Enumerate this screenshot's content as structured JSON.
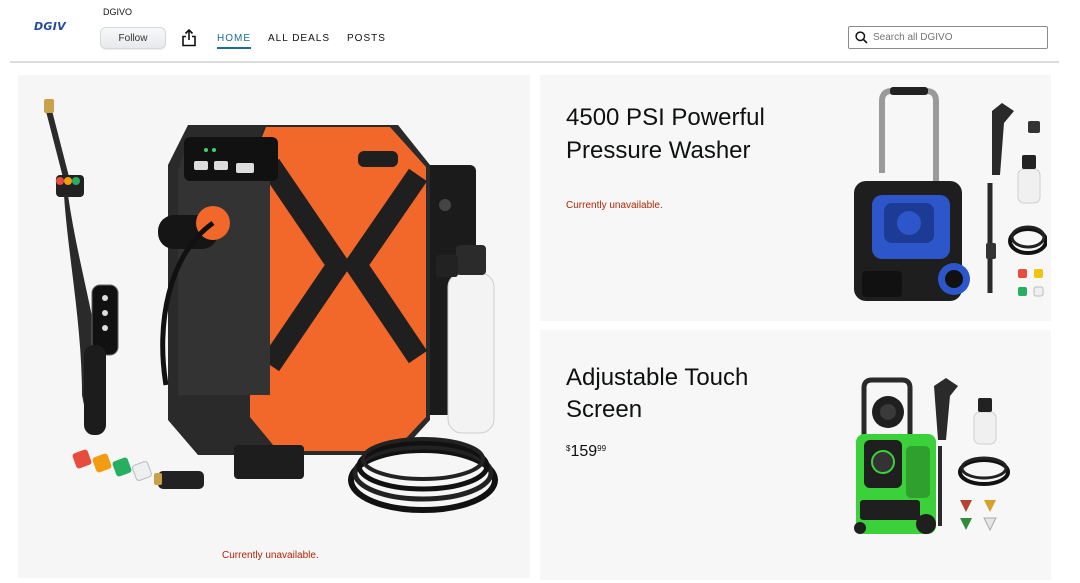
{
  "header": {
    "logo_text": "DGIV",
    "brand_name": "DGIVO",
    "follow_label": "Follow",
    "nav": [
      {
        "label": "HOME",
        "active": true
      },
      {
        "label": "ALL DEALS",
        "active": false
      },
      {
        "label": "POSTS",
        "active": false
      }
    ],
    "search_placeholder": "Search all DGIVO"
  },
  "tiles": {
    "main": {
      "status": "Currently unavailable.",
      "image": "wall-mount-pressure-washer-orange"
    },
    "top": {
      "title_line1": "4500 PSI Powerful",
      "title_line2": "Pressure Washer",
      "status": "Currently unavailable.",
      "image": "blue-pressure-washer-kit"
    },
    "bottom": {
      "title_line1": "Adjustable Touch",
      "title_line2": "Screen",
      "price_symbol": "$",
      "price_whole": "159",
      "price_fraction": "99",
      "image": "green-pressure-washer-kit"
    }
  },
  "colors": {
    "accent": "#1a6e8e",
    "unavailable": "#b12704",
    "orange": "#f2682a"
  }
}
